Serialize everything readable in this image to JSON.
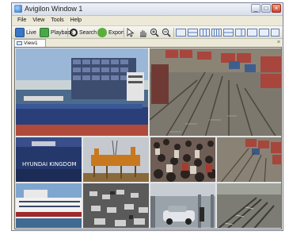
{
  "window": {
    "title": "Avigilon Window 1"
  },
  "window_controls": {
    "minimize": "_",
    "maximize": "□",
    "close": "×"
  },
  "menu": [
    "File",
    "View",
    "Tools",
    "Help"
  ],
  "toolbar": {
    "live": "Live",
    "playback": "Playback",
    "search": "Search",
    "export": "Export"
  },
  "tabs": [
    {
      "label": "View1"
    }
  ],
  "cameras": [
    {
      "scene": "container ship in harbor"
    },
    {
      "scene": "rail yard with containers"
    },
    {
      "scene": "ship hull Hyundai Kingdom",
      "caption": "HYUNDAI KINGDOM"
    },
    {
      "scene": "oil rig construction"
    },
    {
      "scene": "crowd of people"
    },
    {
      "scene": "rail yard wide view"
    },
    {
      "scene": "cruise ship"
    },
    {
      "scene": "parking lot"
    },
    {
      "scene": "garage vehicles"
    },
    {
      "scene": "railway tracks"
    }
  ]
}
